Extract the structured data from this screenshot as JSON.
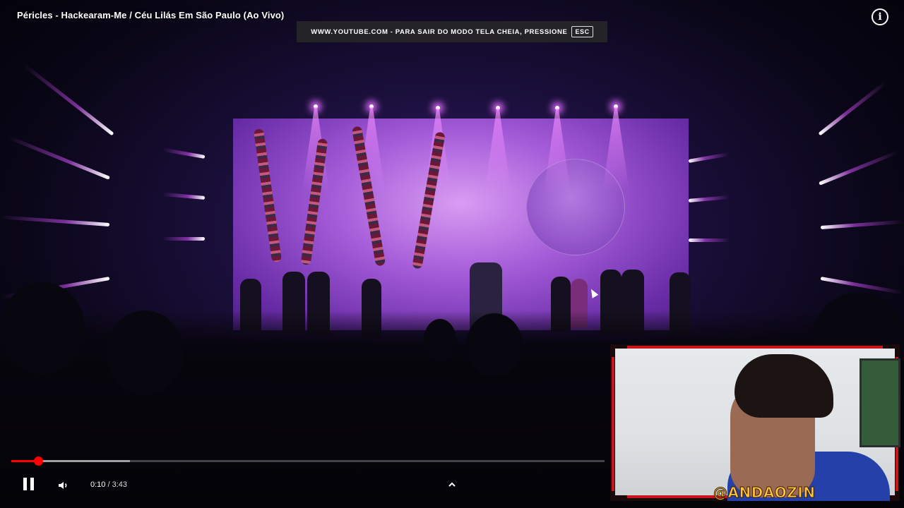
{
  "video": {
    "title": "Péricles - Hackearam-Me / Céu Lilás Em São Paulo (Ao Vivo)",
    "info_icon": "info-icon"
  },
  "fullscreen_notice": {
    "text": "WWW.YOUTUBE.COM - PARA SAIR DO MODO TELA CHEIA, PRESSIONE",
    "key": "ESC"
  },
  "player": {
    "current_time": "0:10",
    "separator": " / ",
    "duration": "3:43",
    "played_fraction": 0.0448,
    "buffered_fraction": 0.2,
    "play_pause_icon": "pause-icon",
    "volume_icon": "volume-icon",
    "expand_icon": "chevron-up-icon"
  },
  "webcam": {
    "streamer_tag": "@ANDAOZIN"
  },
  "colors": {
    "accent": "#ff0000",
    "stage_purple": "#a45bd8",
    "webcam_border": "#c8161c",
    "tag_yellow": "#ffc53a"
  }
}
